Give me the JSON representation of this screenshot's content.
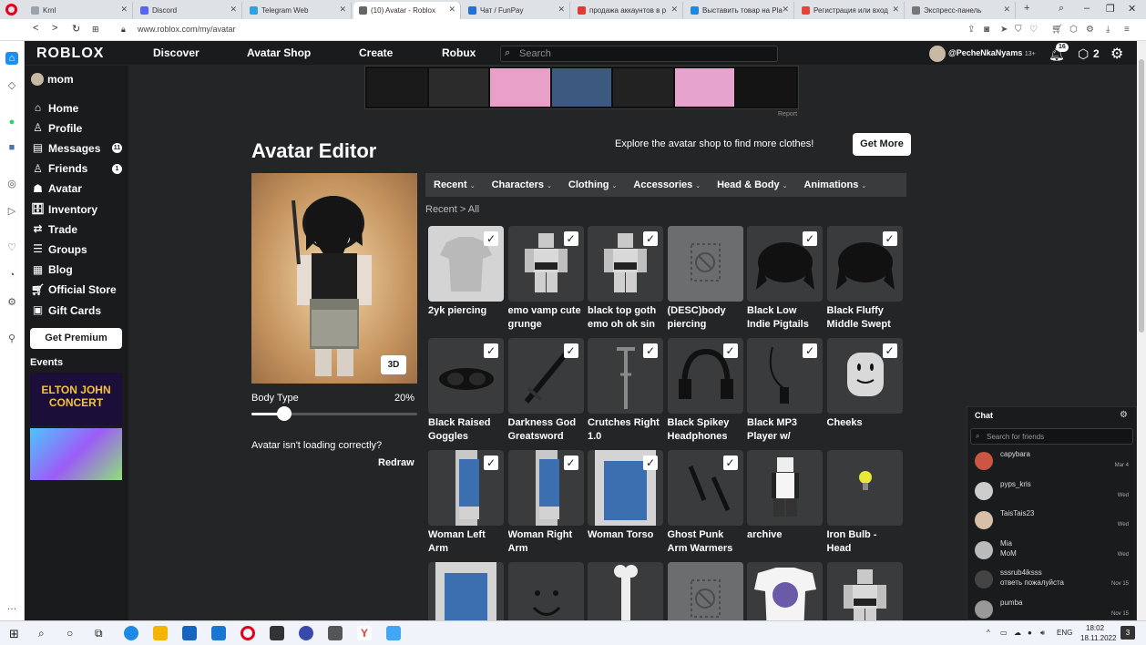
{
  "browser": {
    "tabs": [
      {
        "title": "Krnl",
        "color": "#9ba3ad"
      },
      {
        "title": "Discord",
        "color": "#5865f2"
      },
      {
        "title": "Telegram Web",
        "color": "#2aa3e0"
      },
      {
        "title": "(10) Avatar - Roblox",
        "color": "#666666",
        "active": true
      },
      {
        "title": "Чат / FunPay",
        "color": "#1f72d6"
      },
      {
        "title": "продажа аккаунтов в р",
        "color": "#e53935"
      },
      {
        "title": "Выставить товар на Pla",
        "color": "#1e88e5"
      },
      {
        "title": "Регистрация или вход",
        "color": "#ea4335"
      },
      {
        "title": "Экспресс-панель",
        "color": "#777777"
      }
    ],
    "url": "www.roblox.com/my/avatar"
  },
  "header": {
    "logo": "ROBLOX",
    "nav": [
      "Discover",
      "Avatar Shop",
      "Create",
      "Robux"
    ],
    "search_placeholder": "Search",
    "username": "@PecheNkaNyams",
    "age_tag": "13+",
    "notification_count": "16",
    "robux_count": "2"
  },
  "sidebar": {
    "user": "mom",
    "items": [
      {
        "label": "Home",
        "icon": "home-icon"
      },
      {
        "label": "Profile",
        "icon": "profile-icon"
      },
      {
        "label": "Messages",
        "icon": "messages-icon",
        "badge": "11"
      },
      {
        "label": "Friends",
        "icon": "friends-icon",
        "badge": "1"
      },
      {
        "label": "Avatar",
        "icon": "avatar-icon"
      },
      {
        "label": "Inventory",
        "icon": "inventory-icon"
      },
      {
        "label": "Trade",
        "icon": "trade-icon"
      },
      {
        "label": "Groups",
        "icon": "groups-icon"
      },
      {
        "label": "Blog",
        "icon": "blog-icon"
      },
      {
        "label": "Official Store",
        "icon": "store-icon"
      },
      {
        "label": "Gift Cards",
        "icon": "gift-card-icon"
      }
    ],
    "premium_button": "Get Premium",
    "events_title": "Events",
    "event1_text": "ELTON JOHN\nCONCERT"
  },
  "ad": {
    "report": "Report"
  },
  "editor": {
    "title": "Avatar Editor",
    "explore_text": "Explore the avatar shop to find more clothes!",
    "get_more": "Get More",
    "btn_3d": "3D",
    "body_type_label": "Body Type",
    "body_type_value": "20%",
    "body_type_fraction": 0.2,
    "not_loading": "Avatar isn't loading correctly?",
    "redraw": "Redraw",
    "tabs": [
      "Recent",
      "Characters",
      "Clothing",
      "Accessories",
      "Head & Body",
      "Animations"
    ],
    "breadcrumb": "Recent > All",
    "items": [
      {
        "name": "2yk piercing",
        "checked": true,
        "thumb": "shirt"
      },
      {
        "name": "emo vamp cute grunge",
        "checked": true,
        "thumb": "figure"
      },
      {
        "name": "black top goth emo oh ok sin",
        "checked": true,
        "thumb": "figure"
      },
      {
        "name": "(DESC)body piercing",
        "checked": false,
        "thumb": "placeholder"
      },
      {
        "name": "Black Low Indie Pigtails",
        "checked": true,
        "thumb": "hair"
      },
      {
        "name": "Black Fluffy Middle Swept",
        "checked": true,
        "thumb": "hair"
      },
      {
        "name": "Black Raised Goggles",
        "checked": true,
        "thumb": "goggles"
      },
      {
        "name": "Darkness God Greatsword",
        "checked": true,
        "thumb": "sword"
      },
      {
        "name": "Crutches Right 1.0",
        "checked": true,
        "thumb": "crutch"
      },
      {
        "name": "Black Spikey Headphones",
        "checked": true,
        "thumb": "headphones"
      },
      {
        "name": "Black MP3 Player w/",
        "checked": true,
        "thumb": "mp3"
      },
      {
        "name": "Cheeks",
        "checked": true,
        "thumb": "head"
      },
      {
        "name": "Woman Left Arm",
        "checked": true,
        "thumb": "arm"
      },
      {
        "name": "Woman Right Arm",
        "checked": true,
        "thumb": "arm"
      },
      {
        "name": "Woman Torso",
        "checked": true,
        "thumb": "torso"
      },
      {
        "name": "Ghost Punk Arm Warmers",
        "checked": true,
        "thumb": "warmers"
      },
      {
        "name": "archive",
        "checked": false,
        "thumb": "figure2"
      },
      {
        "name": "Iron Bulb - Head",
        "checked": false,
        "thumb": "bulb"
      },
      {
        "name": "",
        "checked": false,
        "thumb": "torso"
      },
      {
        "name": "",
        "checked": false,
        "thumb": "smile"
      },
      {
        "name": "",
        "checked": false,
        "thumb": "bone"
      },
      {
        "name": "",
        "checked": false,
        "thumb": "placeholder"
      },
      {
        "name": "",
        "checked": false,
        "thumb": "tshirt-anime"
      },
      {
        "name": "",
        "checked": false,
        "thumb": "figure"
      }
    ]
  },
  "chat": {
    "title": "Chat",
    "search_placeholder": "Search for friends",
    "conversations": [
      {
        "name": "capybara",
        "msg": "",
        "date": "Mar 4"
      },
      {
        "name": "pyps_kris",
        "msg": "",
        "date": "Wed"
      },
      {
        "name": "TaisTais23",
        "msg": "",
        "date": "Wed"
      },
      {
        "name": "Mia",
        "msg": "MoM",
        "date": "Wed"
      },
      {
        "name": "sssrub4iksss",
        "msg": "ответь пожалуйста",
        "date": "Nov 15"
      },
      {
        "name": "pumba",
        "msg": "",
        "date": "Nov 15"
      }
    ]
  },
  "taskbar": {
    "lang": "ENG",
    "time": "18:02",
    "date": "18.11.2022",
    "notif": "3"
  }
}
